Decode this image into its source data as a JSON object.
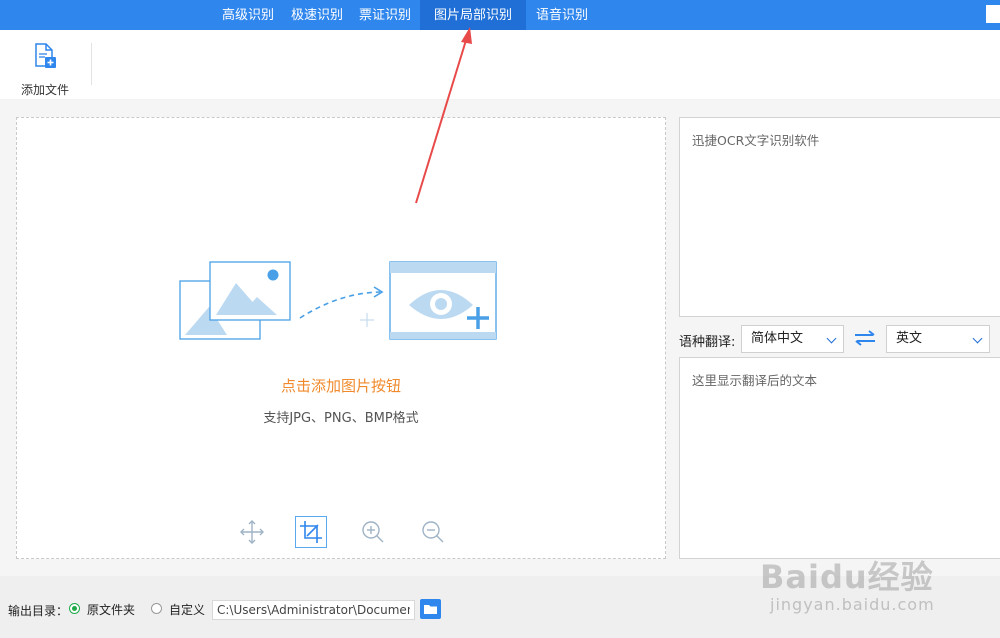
{
  "tabs": [
    {
      "label": "高级识别",
      "active": false
    },
    {
      "label": "极速识别",
      "active": false
    },
    {
      "label": "票证识别",
      "active": false
    },
    {
      "label": "图片局部识别",
      "active": true
    },
    {
      "label": "语音识别",
      "active": false
    }
  ],
  "toolbar": {
    "add_file_label": "添加文件",
    "add_file_icon": "add-file-icon"
  },
  "drop_zone": {
    "title": "点击添加图片按钮",
    "subtitle": "支持JPG、PNG、BMP格式",
    "tools": [
      {
        "name": "move-icon",
        "active": false
      },
      {
        "name": "crop-icon",
        "active": true
      },
      {
        "name": "zoom-in-icon",
        "active": false
      },
      {
        "name": "zoom-out-icon",
        "active": false
      }
    ]
  },
  "result": {
    "text": "迅捷OCR文字识别软件"
  },
  "translation": {
    "label": "语种翻译:",
    "source_lang": "简体中文",
    "target_lang": "英文",
    "placeholder": "这里显示翻译后的文本",
    "swap_icon": "swap-arrows-icon"
  },
  "output": {
    "label": "输出目录：",
    "options": [
      {
        "label": "原文件夹",
        "selected": true
      },
      {
        "label": "自定义",
        "selected": false
      }
    ],
    "path": "C:\\Users\\Administrator\\Documents",
    "folder_icon": "folder-icon"
  },
  "watermark": {
    "brand": "Baidu经验",
    "url": "jingyan.baidu.com"
  },
  "colors": {
    "accent": "#2f86ec",
    "active_tab": "#1f6fd6",
    "highlight": "#f08a2c",
    "arrow": "#e84a4a",
    "radio_selected": "#1faa4a"
  }
}
